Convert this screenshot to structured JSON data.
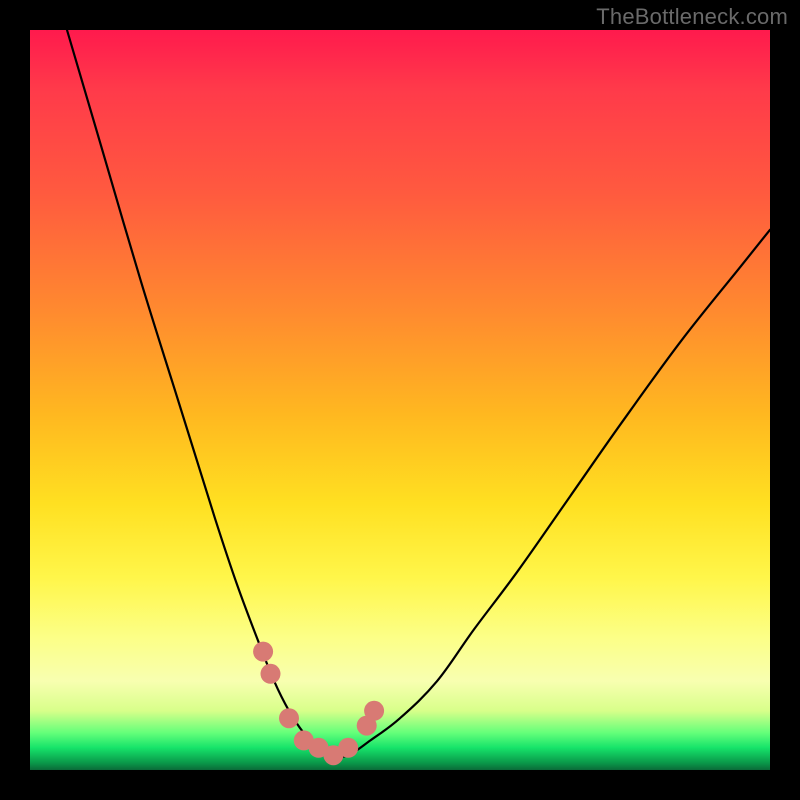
{
  "watermark": "TheBottleneck.com",
  "colors": {
    "frame_bg": "#000000",
    "marker": "#d87a74",
    "curve": "#000000",
    "gradient_top": "#ff1a4d",
    "gradient_bottom": "#0a6a38"
  },
  "chart_data": {
    "type": "line",
    "title": "",
    "xlabel": "",
    "ylabel": "",
    "xlim": [
      0,
      100
    ],
    "ylim": [
      0,
      100
    ],
    "grid": false,
    "legend": false,
    "series": [
      {
        "name": "bottleneck-curve",
        "x": [
          5,
          10,
          15,
          20,
          25,
          28,
          31,
          33,
          35,
          37,
          39,
          41,
          43,
          46,
          50,
          55,
          60,
          66,
          73,
          80,
          88,
          96,
          100
        ],
        "values": [
          100,
          83,
          66,
          50,
          34,
          25,
          17,
          12,
          8,
          5,
          3,
          2,
          2,
          4,
          7,
          12,
          19,
          27,
          37,
          47,
          58,
          68,
          73
        ]
      }
    ],
    "markers": {
      "name": "highlight-points",
      "x": [
        31.5,
        32.5,
        35,
        37,
        39,
        41,
        43,
        45.5,
        46.5
      ],
      "values": [
        16,
        13,
        7,
        4,
        3,
        2,
        3,
        6,
        8
      ]
    }
  }
}
